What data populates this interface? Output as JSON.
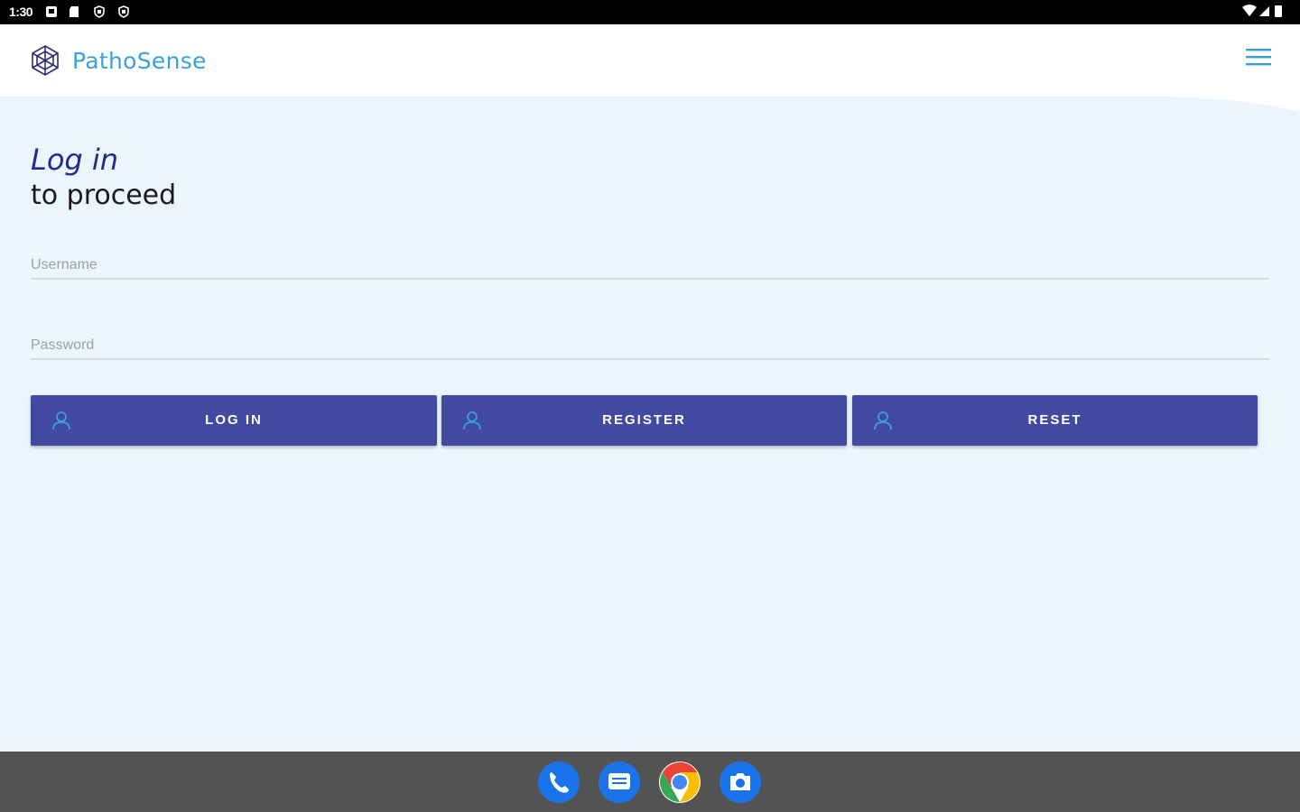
{
  "status_bar": {
    "time": "1:30"
  },
  "header": {
    "brand": "PathoSense"
  },
  "login": {
    "title": "Log in",
    "subtitle": "to proceed",
    "username_placeholder": "Username",
    "password_placeholder": "Password"
  },
  "buttons": {
    "login": "LOG IN",
    "register": "REGISTER",
    "reset": "RESET"
  },
  "colors": {
    "primary": "#4249a0",
    "brand_text": "#3aa0d8",
    "background": "#eaf5fd",
    "heading": "#1f2b8e"
  },
  "dock": {
    "apps": [
      "phone-icon",
      "messages-icon",
      "chrome-icon",
      "camera-icon"
    ]
  }
}
